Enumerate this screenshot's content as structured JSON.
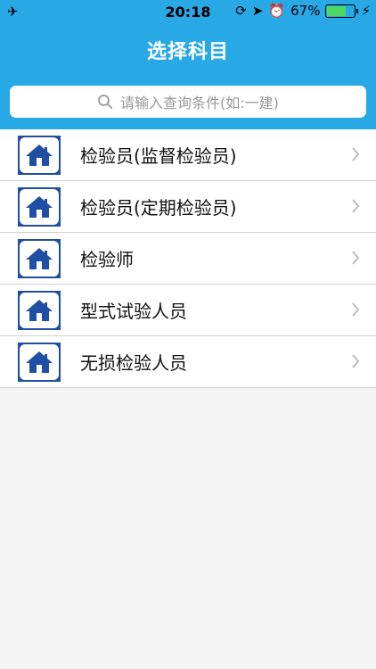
{
  "status": {
    "time": "20:18",
    "battery": "67%",
    "battery_level": 0.67
  },
  "header": {
    "title": "选择科目"
  },
  "search": {
    "placeholder": "请输入查询条件(如:一建)"
  },
  "items": [
    {
      "label": "检验员(监督检验员)"
    },
    {
      "label": "检验员(定期检验员)"
    },
    {
      "label": "检验师"
    },
    {
      "label": "型式试验人员"
    },
    {
      "label": "无损检验人员"
    }
  ],
  "colors": {
    "header": "#29a8e6",
    "icon": "#1f4fa3"
  }
}
